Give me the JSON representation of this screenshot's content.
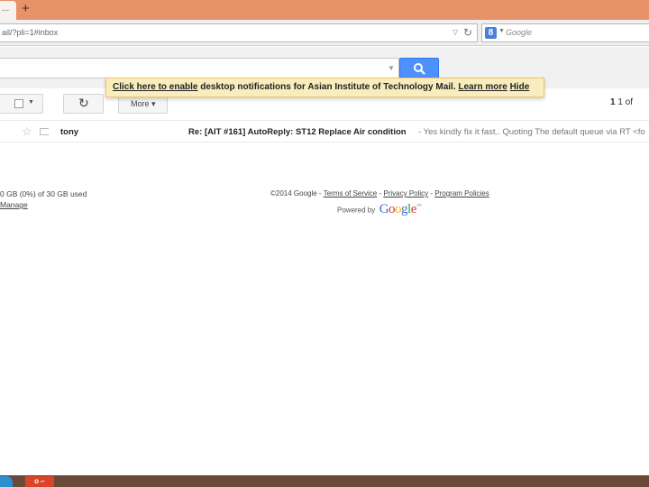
{
  "browser": {
    "tab_title": "...",
    "new_tab_symbol": "+",
    "url": "ail/?pli=1#inbox",
    "search_placeholder": "Google",
    "search_engine_icon": "8",
    "reload_symbol": "↻",
    "dropdown_symbol": "▽"
  },
  "gmail": {
    "search_value": "",
    "notification": {
      "enable_link": "Click here to enable",
      "message": " desktop notifications for Asian Institute of Technology Mail.",
      "learn_more": "Learn more",
      "hide": "Hide"
    },
    "toolbar": {
      "more_label": "More ▾",
      "refresh_symbol": "↻",
      "pager_range": "1",
      "pager_rest": " 1 of"
    },
    "messages": [
      {
        "sender": "tony",
        "subject": "Re: [AIT #161] AutoReply: ST12 Replace Air condition",
        "snippet": " - Yes kindly fix it fast.. Quoting The default queue via RT <fo"
      }
    ],
    "footer": {
      "storage": "0 GB (0%) of 30 GB used",
      "manage": "Manage",
      "copyright": "©2014 Google - ",
      "terms": "Terms of Service",
      "sep1": " - ",
      "privacy": "Privacy Policy",
      "sep2": " - ",
      "program": "Program Policies",
      "powered_by": "Powered by"
    }
  },
  "taskbar": {
    "office_label": "o ⌐"
  },
  "colors": {
    "tabbar": "#e8926a",
    "search_button": "#4d90fe",
    "notification_bg": "#f9edbe",
    "taskbar": "#6b4a3a"
  }
}
